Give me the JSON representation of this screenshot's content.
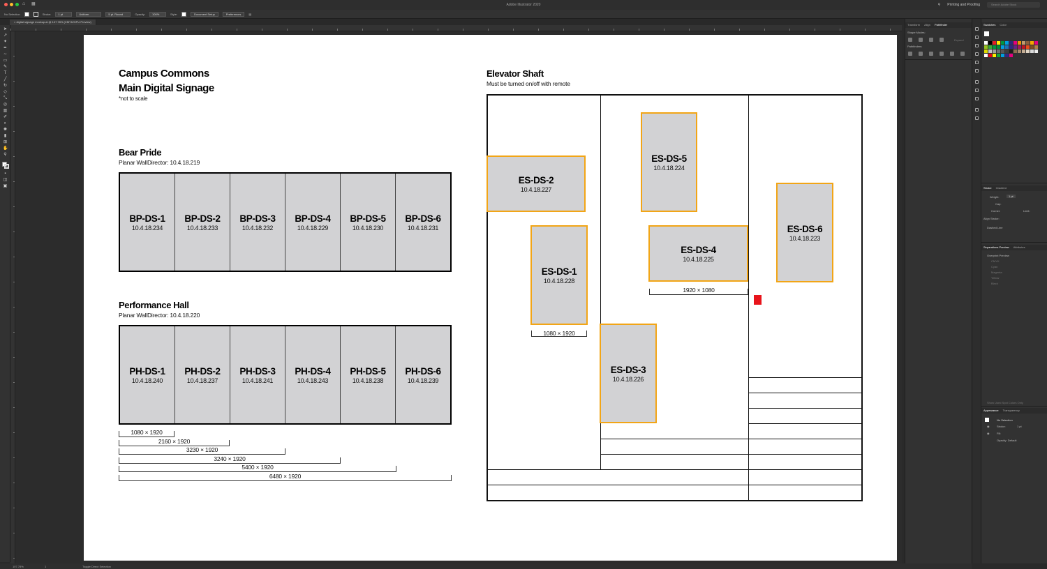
{
  "window": {
    "app_title": "Adobe Illustrator 2020",
    "workspace": "Printing and Proofing",
    "search_placeholder": "Search Adobe Stock"
  },
  "control_bar": {
    "selection": "No Selection",
    "stroke_label": "Stroke:",
    "stroke_value": "1 pt",
    "profile_value": "Uniform",
    "brush_value": "5 pt. Round",
    "opacity_label": "Opacity:",
    "opacity_value": "100%",
    "style_label": "Style:",
    "doc_setup_label": "Document Setup",
    "preferences_label": "Preferences"
  },
  "document_tab": {
    "label": "digital signage mockup.ai @ 107.78% (CMYK/GPU Preview)"
  },
  "artboard": {
    "title_line1": "Campus Commons",
    "title_line2": "Main Digital Signage",
    "note": "*not to scale",
    "bear_pride": {
      "title": "Bear Pride",
      "subtitle": "Planar WallDirector: 10.4.18.219",
      "panels": [
        {
          "name": "BP-DS-1",
          "ip": "10.4.18.234"
        },
        {
          "name": "BP-DS-2",
          "ip": "10.4.18.233"
        },
        {
          "name": "BP-DS-3",
          "ip": "10.4.18.232"
        },
        {
          "name": "BP-DS-4",
          "ip": "10.4.18.229"
        },
        {
          "name": "BP-DS-5",
          "ip": "10.4.18.230"
        },
        {
          "name": "BP-DS-6",
          "ip": "10.4.18.231"
        }
      ]
    },
    "performance_hall": {
      "title": "Performance Hall",
      "subtitle": "Planar WallDirector: 10.4.18.220",
      "panels": [
        {
          "name": "PH-DS-1",
          "ip": "10.4.18.240"
        },
        {
          "name": "PH-DS-2",
          "ip": "10.4.18.237"
        },
        {
          "name": "PH-DS-3",
          "ip": "10.4.18.241"
        },
        {
          "name": "PH-DS-4",
          "ip": "10.4.18.243"
        },
        {
          "name": "PH-DS-5",
          "ip": "10.4.18.238"
        },
        {
          "name": "PH-DS-6",
          "ip": "10.4.18.239"
        }
      ],
      "dimensions": [
        "1080 × 1920",
        "2160 × 1920",
        "3230 × 1920",
        "3240 × 1920",
        "5400 × 1920",
        "6480 × 1920"
      ]
    },
    "elevator_shaft": {
      "title": "Elevator Shaft",
      "subtitle": "Must be turned on/off with remote",
      "screens": {
        "es1": {
          "name": "ES-DS-1",
          "ip": "10.4.18.228"
        },
        "es2": {
          "name": "ES-DS-2",
          "ip": "10.4.18.227"
        },
        "es3": {
          "name": "ES-DS-3",
          "ip": "10.4.18.226"
        },
        "es4": {
          "name": "ES-DS-4",
          "ip": "10.4.18.225"
        },
        "es5": {
          "name": "ES-DS-5",
          "ip": "10.4.18.224"
        },
        "es6": {
          "name": "ES-DS-6",
          "ip": "10.4.18.223"
        }
      },
      "dim_portrait": "1080 × 1920",
      "dim_landscape": "1920 × 1080"
    }
  },
  "panels": {
    "top_tabs": [
      "Transform",
      "Align",
      "Pathfinder"
    ],
    "shape_modes": "Shape Modes:",
    "pathfinders": "Pathfinders:",
    "expand": "Expand",
    "swatch_tabs": [
      "Swatches",
      "Color"
    ],
    "stroke_tabs": [
      "Stroke",
      "Gradient"
    ],
    "weight_label": "Weight:",
    "weight_value": "1 pt",
    "cap_label": "Cap:",
    "corner_label": "Corner:",
    "limit_label": "Limit:",
    "align_stroke_label": "Align Stroke:",
    "dashed_line": "Dashed Line",
    "sep_tabs": [
      "Separations Preview",
      "Attributes"
    ],
    "overprint_preview": "Overprint Preview",
    "separations": [
      "CMYK",
      "Cyan",
      "Magenta",
      "Yellow",
      "Black"
    ],
    "used_spot": "Show Used Spot Colors Only",
    "appearance_tabs": [
      "Appearance",
      "Transparency"
    ],
    "appearance_selection": "No Selection",
    "stroke_row": "Stroke:",
    "stroke_row_value": "1 pt",
    "fill_row": "Fill:",
    "opacity_row": "Opacity: Default"
  },
  "status_bar": {
    "zoom": "107.78%",
    "page": "1",
    "tool_hint": "Toggle Direct Selection"
  },
  "colors": {
    "screen_border": "#f2a516",
    "screen_fill": "#d2d2d4",
    "marker": "#e8141b"
  }
}
